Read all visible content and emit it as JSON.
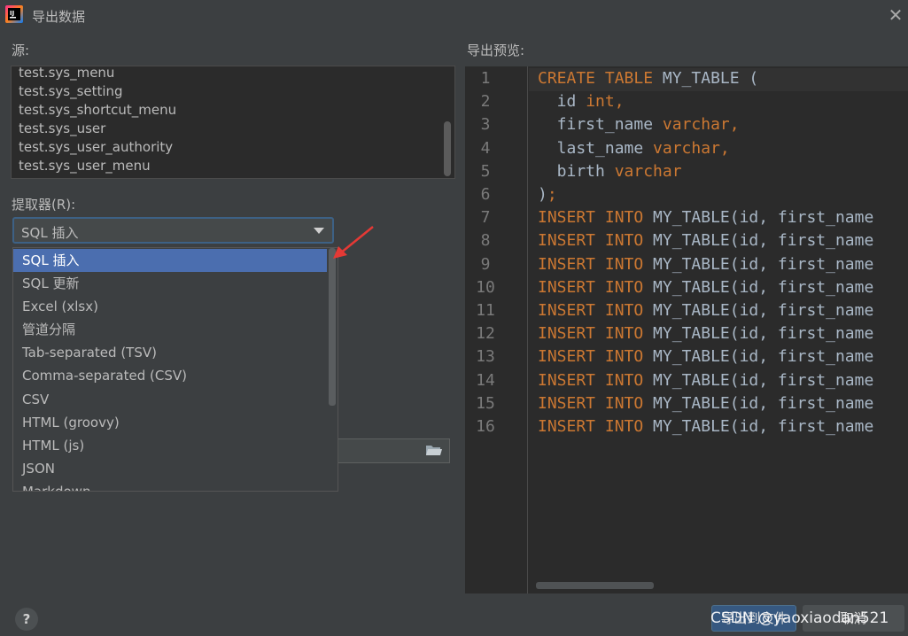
{
  "window": {
    "title": "导出数据"
  },
  "source": {
    "label": "源:",
    "items": [
      "test.sys_menu",
      "test.sys_setting",
      "test.sys_shortcut_menu",
      "test.sys_user",
      "test.sys_user_authority",
      "test.sys_user_menu"
    ]
  },
  "extractor": {
    "label": "提取器(R):",
    "value": "SQL 插入",
    "options": [
      "SQL 插入",
      "SQL 更新",
      "Excel (xlsx)",
      "管道分隔",
      "Tab-separated (TSV)",
      "Comma-separated (CSV)",
      "CSV",
      "HTML (groovy)",
      "HTML (js)",
      "JSON",
      "Markdown"
    ],
    "selected_index": 0
  },
  "preview": {
    "label": "导出预览:",
    "lines": [
      {
        "n": "1",
        "parts": [
          [
            "kw",
            "CREATE TABLE"
          ],
          [
            "t",
            " MY_TABLE ("
          ]
        ]
      },
      {
        "n": "2",
        "parts": [
          [
            "t",
            "  id "
          ],
          [
            "kw",
            "int,"
          ]
        ]
      },
      {
        "n": "3",
        "parts": [
          [
            "t",
            "  first_name "
          ],
          [
            "kw",
            "varchar,"
          ]
        ]
      },
      {
        "n": "4",
        "parts": [
          [
            "t",
            "  last_name "
          ],
          [
            "kw",
            "varchar,"
          ]
        ]
      },
      {
        "n": "5",
        "parts": [
          [
            "t",
            "  birth "
          ],
          [
            "kw",
            "varchar"
          ]
        ]
      },
      {
        "n": "6",
        "parts": [
          [
            "t",
            ")"
          ],
          [
            "kw",
            ";"
          ]
        ]
      },
      {
        "n": "7",
        "parts": [
          [
            "kw",
            "INSERT INTO"
          ],
          [
            "t",
            " MY_TABLE(id, first_name"
          ]
        ]
      },
      {
        "n": "8",
        "parts": [
          [
            "kw",
            "INSERT INTO"
          ],
          [
            "t",
            " MY_TABLE(id, first_name"
          ]
        ]
      },
      {
        "n": "9",
        "parts": [
          [
            "kw",
            "INSERT INTO"
          ],
          [
            "t",
            " MY_TABLE(id, first_name"
          ]
        ]
      },
      {
        "n": "10",
        "parts": [
          [
            "kw",
            "INSERT INTO"
          ],
          [
            "t",
            " MY_TABLE(id, first_name"
          ]
        ]
      },
      {
        "n": "11",
        "parts": [
          [
            "kw",
            "INSERT INTO"
          ],
          [
            "t",
            " MY_TABLE(id, first_name"
          ]
        ]
      },
      {
        "n": "12",
        "parts": [
          [
            "kw",
            "INSERT INTO"
          ],
          [
            "t",
            " MY_TABLE(id, first_name"
          ]
        ]
      },
      {
        "n": "13",
        "parts": [
          [
            "kw",
            "INSERT INTO"
          ],
          [
            "t",
            " MY_TABLE(id, first_name"
          ]
        ]
      },
      {
        "n": "14",
        "parts": [
          [
            "kw",
            "INSERT INTO"
          ],
          [
            "t",
            " MY_TABLE(id, first_name"
          ]
        ]
      },
      {
        "n": "15",
        "parts": [
          [
            "kw",
            "INSERT INTO"
          ],
          [
            "t",
            " MY_TABLE(id, first_name"
          ]
        ]
      },
      {
        "n": "16",
        "parts": [
          [
            "kw",
            "INSERT INTO"
          ],
          [
            "t",
            " MY_TABLE(id, first_name"
          ]
        ]
      }
    ]
  },
  "buttons": {
    "help": "?",
    "export": "导出到文件",
    "cancel": "取消"
  },
  "watermark": "CSDN @yaoxiaodan521",
  "colors": {
    "keyword": "#cc7832",
    "selection": "#4b6eaf",
    "annotation_arrow": "#e53935"
  },
  "icons": {
    "app": "intellij-icon",
    "close": "close-icon",
    "folder": "folder-icon",
    "combo": "chevron-down-icon"
  }
}
